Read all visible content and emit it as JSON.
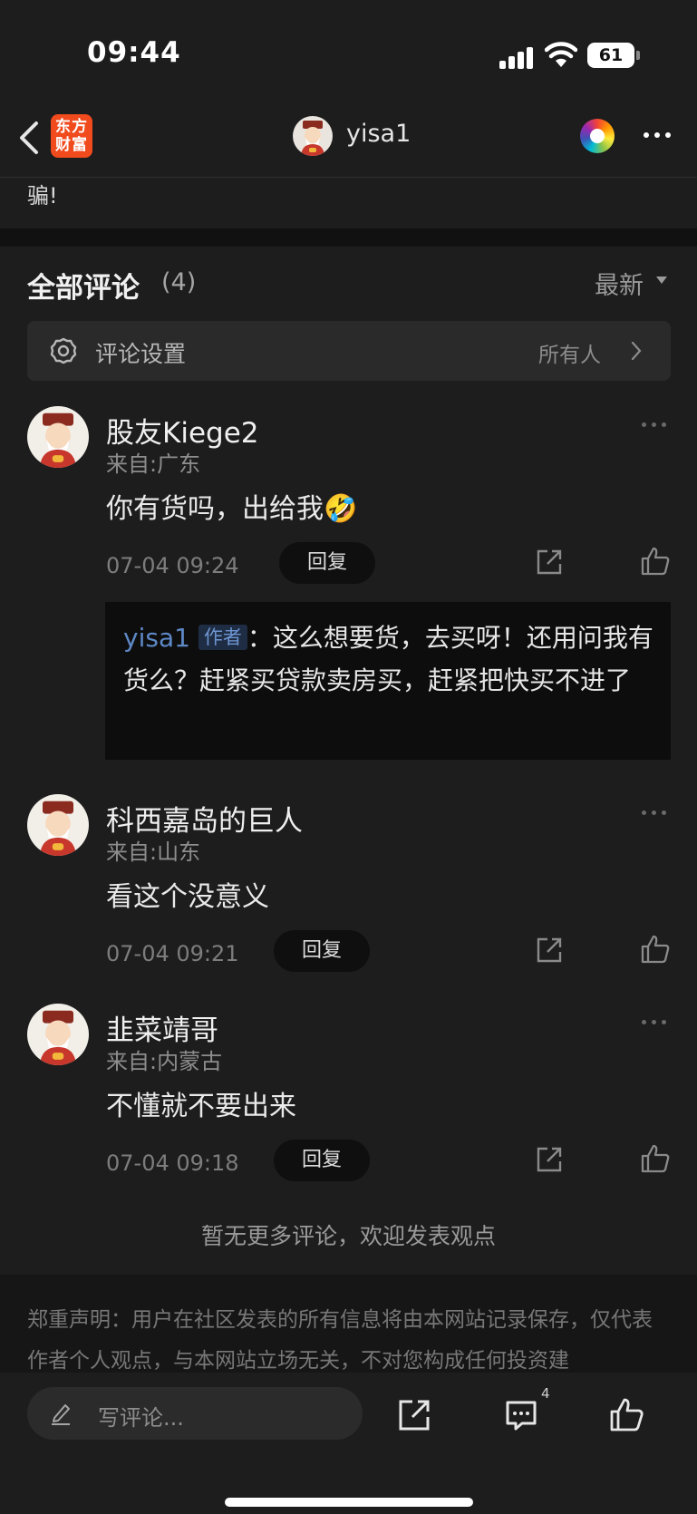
{
  "status_bar": {
    "time": "09:44",
    "battery": "61"
  },
  "nav": {
    "logo_line1": "东方",
    "logo_line2": "财富",
    "username": "yisa1"
  },
  "post": {
    "tail_text": "骗!"
  },
  "comments_header": {
    "title": "全部评论",
    "count": "(4)",
    "sort": "最新"
  },
  "settings": {
    "label": "评论设置",
    "value": "所有人"
  },
  "comments": [
    {
      "name": "股友Kiege2",
      "location": "来自:广东",
      "text": "你有货吗，出给我🤣",
      "time": "07-04 09:24",
      "reply_label": "回复",
      "replies": [
        {
          "author": "yisa1",
          "tag": "作者",
          "text": "：这么想要货，去买呀！还用问我有货么？赶紧买贷款卖房买，赶紧把快买不进了"
        }
      ]
    },
    {
      "name": "科西嘉岛的巨人",
      "location": "来自:山东",
      "text": "看这个没意义",
      "time": "07-04 09:21",
      "reply_label": "回复"
    },
    {
      "name": "韭菜靖哥",
      "location": "来自:内蒙古",
      "text": "不懂就不要出来",
      "time": "07-04 09:18",
      "reply_label": "回复"
    }
  ],
  "footer": {
    "no_more": "暂无更多评论，欢迎发表观点",
    "disclaimer": "郑重声明：用户在社区发表的所有信息将由本网站记录保存，仅代表作者个人观点，与本网站立场无关，不对您构成任何投资建"
  },
  "bottom_bar": {
    "placeholder": "写评论...",
    "comment_count": "4"
  }
}
